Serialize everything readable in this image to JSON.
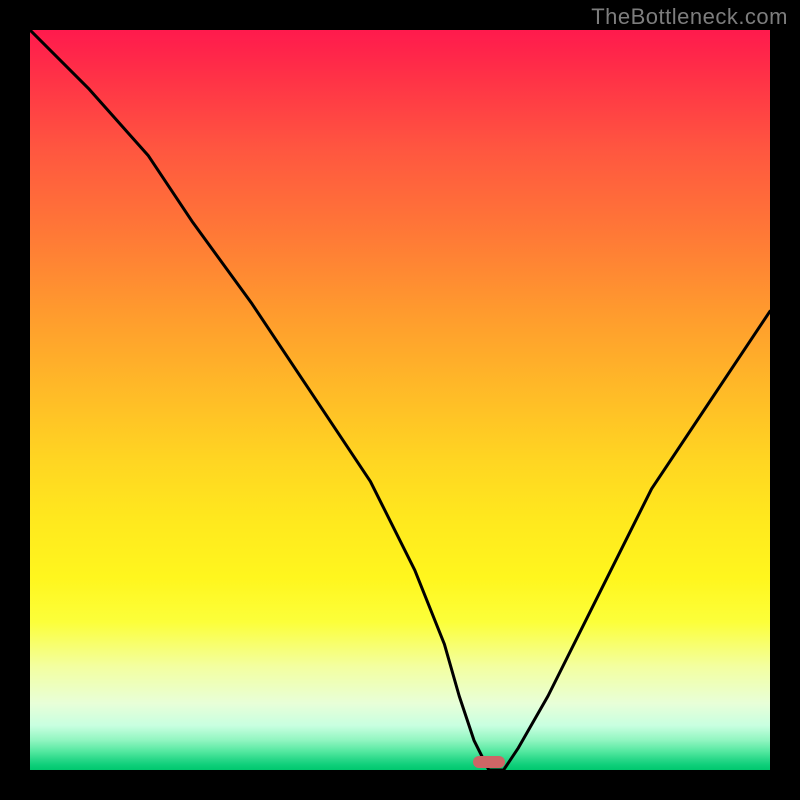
{
  "watermark": "TheBottleneck.com",
  "chart_data": {
    "type": "line",
    "title": "",
    "xlabel": "",
    "ylabel": "",
    "x_range": [
      0,
      100
    ],
    "y_range": [
      0,
      100
    ],
    "series": [
      {
        "name": "bottleneck-curve",
        "x": [
          0,
          8,
          16,
          22,
          30,
          38,
          46,
          52,
          56,
          58,
          60,
          62,
          64,
          66,
          70,
          76,
          84,
          92,
          100
        ],
        "y": [
          100,
          92,
          83,
          74,
          63,
          51,
          39,
          27,
          17,
          10,
          4,
          0,
          0,
          3,
          10,
          22,
          38,
          50,
          62
        ]
      }
    ],
    "marker": {
      "name": "optimal-zone",
      "x_center": 62,
      "y": 0,
      "width_pct": 4.4,
      "height_pct": 1.6,
      "color": "#cc6666"
    },
    "background_gradient": {
      "top": "#ff1a4d",
      "mid": "#ffe81e",
      "bottom": "#00c86e"
    }
  }
}
